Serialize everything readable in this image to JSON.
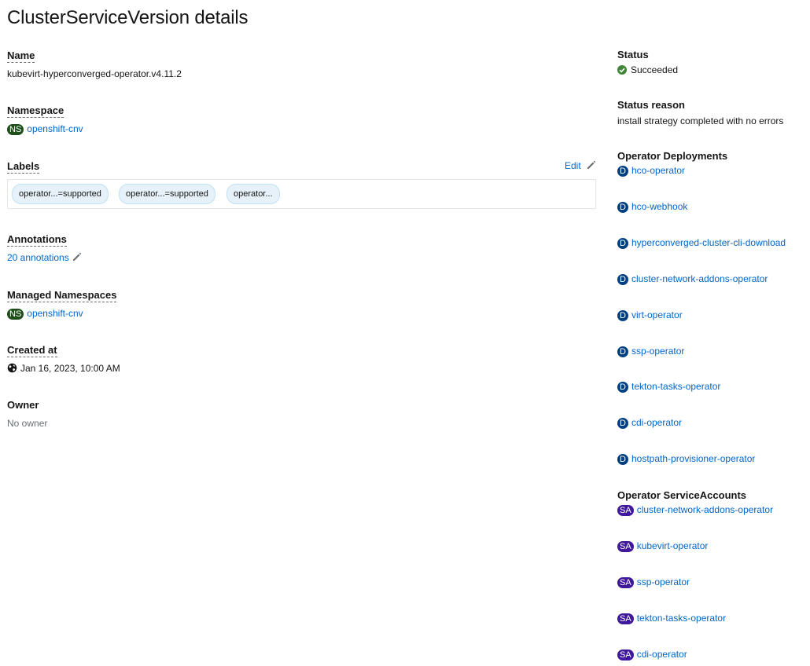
{
  "page": {
    "title": "ClusterServiceVersion details"
  },
  "left": {
    "name": {
      "label": "Name",
      "value": "kubevirt-hyperconverged-operator.v4.11.2"
    },
    "namespace": {
      "label": "Namespace",
      "badge": "NS",
      "value": "openshift-cnv"
    },
    "labels": {
      "label": "Labels",
      "edit_label": "Edit",
      "chips": [
        "operator...=supported",
        "operator...=supported",
        "operator..."
      ]
    },
    "annotations": {
      "label": "Annotations",
      "value": "20 annotations"
    },
    "managed_namespaces": {
      "label": "Managed Namespaces",
      "badge": "NS",
      "value": "openshift-cnv"
    },
    "created_at": {
      "label": "Created at",
      "value": "Jan 16, 2023, 10:00 AM"
    },
    "owner": {
      "label": "Owner",
      "value": "No owner"
    }
  },
  "right": {
    "status": {
      "label": "Status",
      "value": "Succeeded"
    },
    "status_reason": {
      "label": "Status reason",
      "value": "install strategy completed with no errors"
    },
    "deployments": {
      "label": "Operator Deployments",
      "badge": "D",
      "items": [
        "hco-operator",
        "hco-webhook",
        "hyperconverged-cluster-cli-download",
        "cluster-network-addons-operator",
        "virt-operator",
        "ssp-operator",
        "tekton-tasks-operator",
        "cdi-operator",
        "hostpath-provisioner-operator"
      ]
    },
    "service_accounts": {
      "label": "Operator ServiceAccounts",
      "badge": "SA",
      "items": [
        "cluster-network-addons-operator",
        "kubevirt-operator",
        "ssp-operator",
        "tekton-tasks-operator",
        "cdi-operator"
      ]
    }
  },
  "colors": {
    "link": "#0066cc",
    "ns_badge": "#1e4f18",
    "deployment_badge": "#004080",
    "sa_badge": "#40199a",
    "success": "#3e8635"
  }
}
